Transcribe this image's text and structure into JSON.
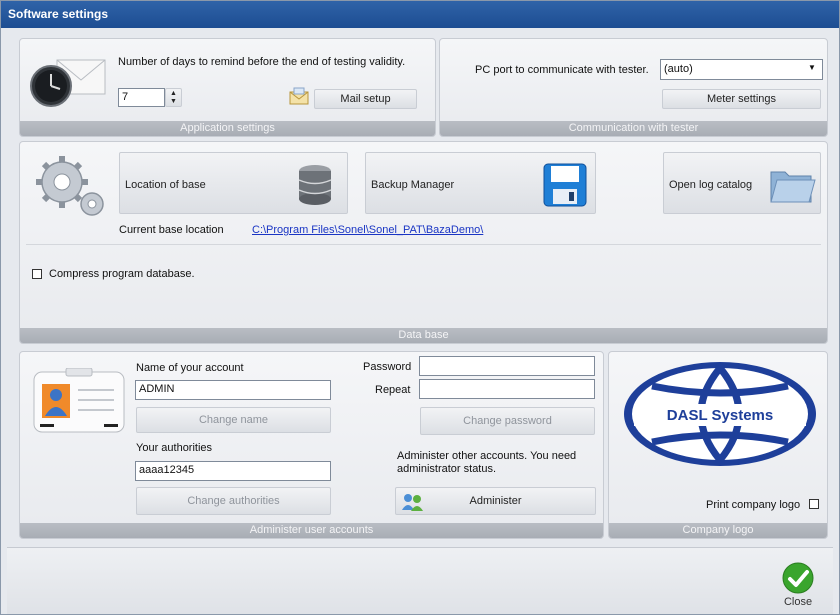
{
  "window": {
    "title": "Software settings"
  },
  "app_settings": {
    "remind_label": "Number of days to remind before the end of testing validity.",
    "remind_days": "7",
    "mail_setup_label": "Mail setup",
    "footer": "Application settings"
  },
  "communication": {
    "port_label": "PC port to communicate with tester.",
    "port_value": "(auto)",
    "meter_settings_label": "Meter settings",
    "footer": "Communication with tester"
  },
  "database": {
    "location_label": "Location of base",
    "backup_label": "Backup Manager",
    "log_label": "Open log catalog",
    "current_label": "Current base location",
    "current_path": "C:\\Program Files\\Sonel\\Sonel_PAT\\BazaDemo\\",
    "compress_label": "Compress program database.",
    "footer": "Data base"
  },
  "accounts": {
    "name_label": "Name of your account",
    "name_value": "ADMIN",
    "change_name_label": "Change name",
    "authorities_label": "Your authorities",
    "authorities_value": "aaaa12345",
    "change_authorities_label": "Change authorities",
    "password_label": "Password",
    "repeat_label": "Repeat",
    "change_password_label": "Change password",
    "administer_info": "Administer other accounts. You need administrator status.",
    "administer_label": "Administer",
    "footer": "Administer user accounts"
  },
  "company": {
    "logo_text": "DASL Systems",
    "print_logo_label": "Print company logo",
    "footer": "Company logo"
  },
  "bottom": {
    "close_label": "Close"
  },
  "colors": {
    "title_bar": "#1d4d92",
    "panel_footer": "#aeb2ba",
    "logo_blue": "#1e3f9a",
    "close_green": "#3aa52d",
    "link": "#1a35c4"
  }
}
